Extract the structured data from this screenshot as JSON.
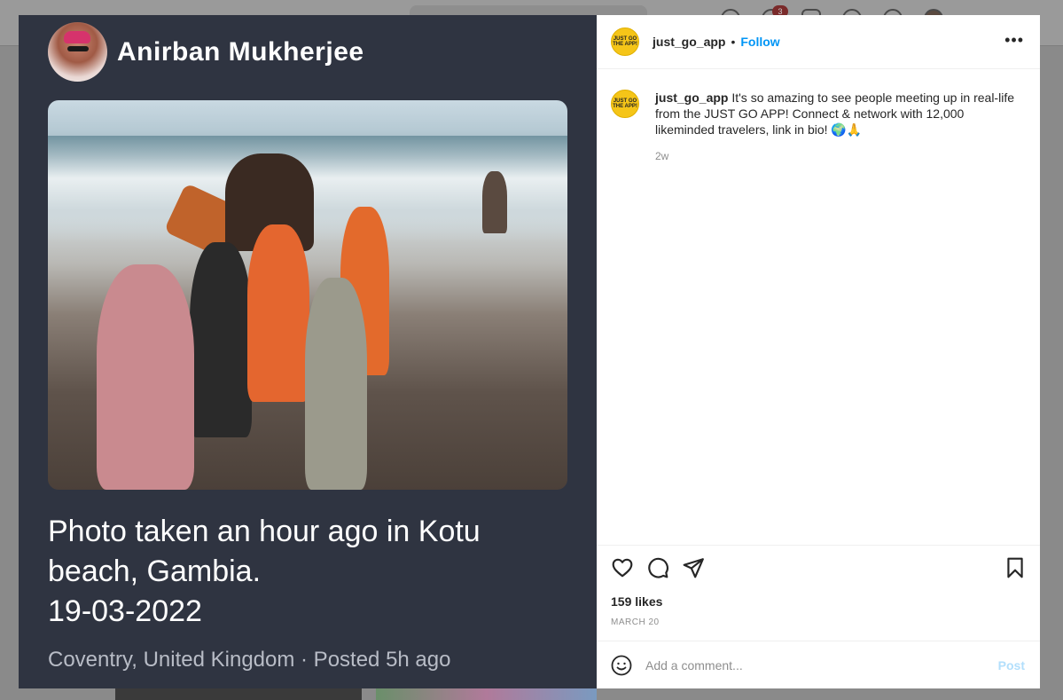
{
  "background": {
    "notification_count": "3"
  },
  "left_panel": {
    "author_name": "Anirban Mukherjee",
    "caption_lines": [
      "Photo taken an hour ago in Kotu",
      "beach, Gambia.",
      "19-03-2022"
    ],
    "location_posted": "Coventry, United Kingdom · Posted 5h ago"
  },
  "post": {
    "username": "just_go_app",
    "separator": "•",
    "follow_label": "Follow",
    "more_label": "•••",
    "avatar_text": "JUST GO THE APP!",
    "caption_text": "It's so amazing to see people meeting up in real-life from the JUST GO APP! Connect & network with 12,000 likeminded travelers, link in bio! 🌍🙏",
    "time_ago": "2w",
    "likes": "159 likes",
    "date": "MARCH 20",
    "comment_placeholder": "Add a comment...",
    "post_label": "Post"
  },
  "colors": {
    "left_bg": "#2f3441",
    "follow": "#0095f6",
    "post_disabled": "#b2dffc",
    "avatar_yellow": "#f5c518"
  },
  "icons": [
    "heart-icon",
    "comment-icon",
    "share-icon",
    "bookmark-icon",
    "emoji-icon",
    "more-icon"
  ]
}
